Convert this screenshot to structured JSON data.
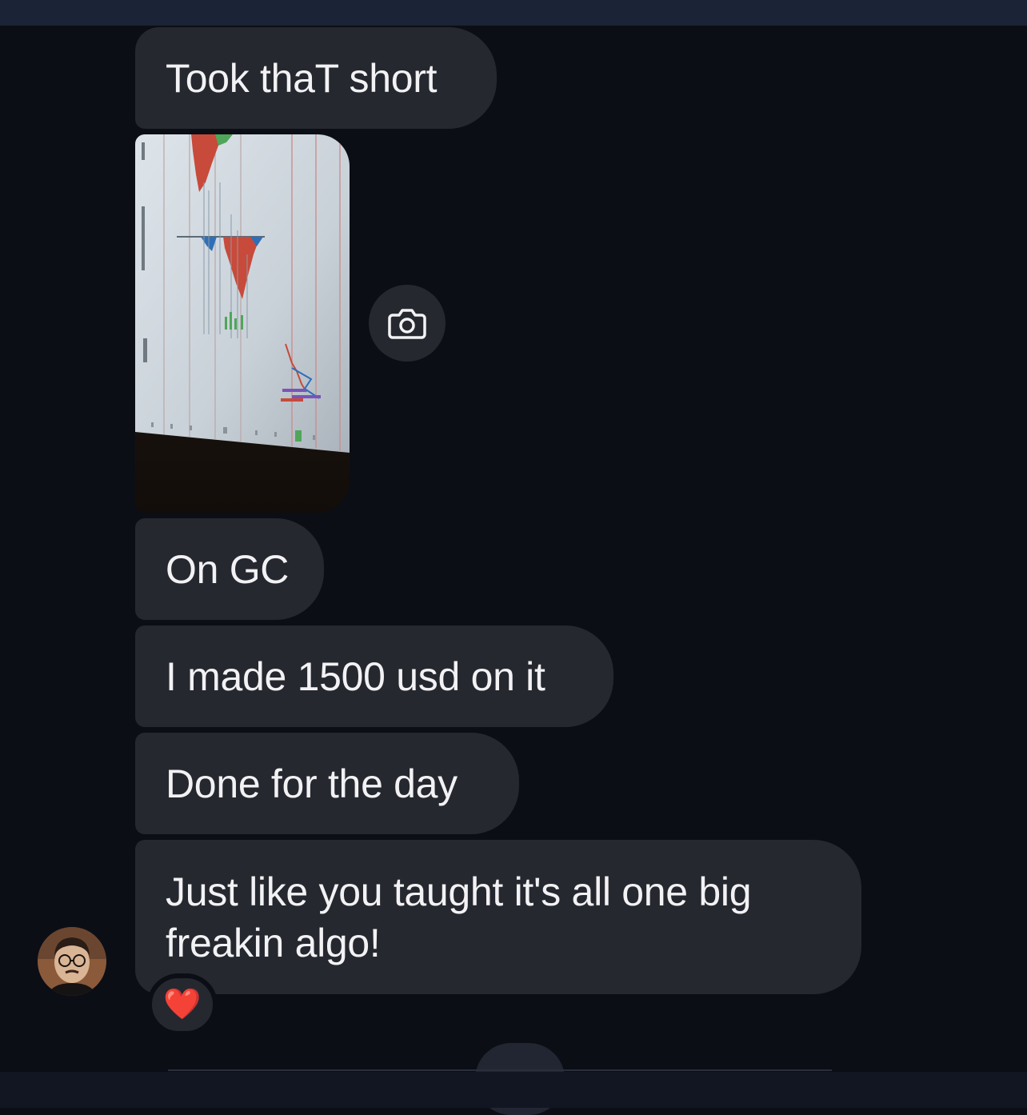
{
  "messages": [
    {
      "text": "Took thaT short"
    },
    {
      "text": "On GC"
    },
    {
      "text": "I made 1500 usd on it"
    },
    {
      "text": "Done for the day"
    },
    {
      "text": "Just like you taught it's all one big freakin algo!"
    }
  ],
  "photo_message": {
    "icon": "trading-chart-photo"
  },
  "camera_button": {
    "icon": "camera-icon"
  },
  "reaction": {
    "emoji": "❤️"
  },
  "colors": {
    "background": "#0c0e15",
    "bubble": "#262830",
    "text": "#f2f2f4",
    "top_strip": "#1b2436"
  }
}
